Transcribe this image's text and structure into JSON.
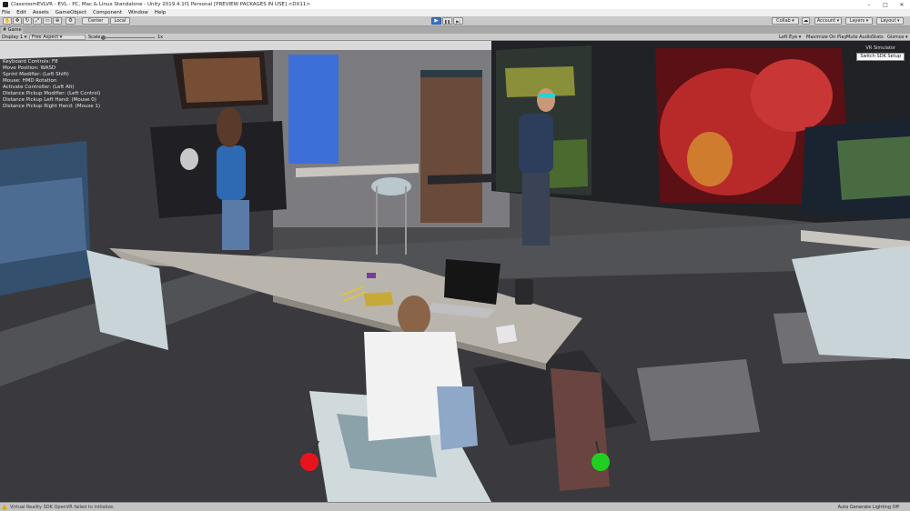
{
  "window": {
    "title": "ClassroomEVLVR - EVL - PC, Mac & Linux Standalone - Unity 2019.4.1f1 Personal [PREVIEW PACKAGES IN USE] <DX11>",
    "controls": [
      "–",
      "□",
      "✕"
    ]
  },
  "menu": [
    "File",
    "Edit",
    "Assets",
    "GameObject",
    "Component",
    "Window",
    "Help"
  ],
  "toolbar": {
    "center_label": "Center",
    "local_label": "Local",
    "play_icon": "▶",
    "pause_icon": "❚❚",
    "step_icon": "▶|",
    "collab_label": "Collab ▾",
    "account_label": "Account ▾",
    "layers_label": "Layers ▾",
    "layout_label": "Layout ▾"
  },
  "tabs": {
    "game": "# Game"
  },
  "gameview": {
    "display": "Display 1 ▾",
    "aspect": "Free Aspect ▾",
    "scale_label": "Scale",
    "scale_value": "1x",
    "eye": "Left Eye ▾",
    "maximize": "Maximize On Play",
    "mute": "Mute Audio",
    "stats": "Stats",
    "gizmos": "Gizmos ▾"
  },
  "debug_overlay": {
    "lines": [
      "Keyboard Controls: F8",
      "Move Position: WASD",
      "Sprint Modifier: (Left Shift)",
      "",
      "Mouse: HMD Rotation",
      "Activate Controller: (Left Alt)",
      "Distance Pickup Modifier: (Left Control)",
      "Distance Pickup Left Hand: (Mouse 0)",
      "Distance Pickup Right Hand: (Mouse 1)"
    ]
  },
  "sdk": {
    "label": "VR Simulator",
    "button": "Switch SDK Setup"
  },
  "status": {
    "message": "Virtual Reality SDK OpenVR failed to initialize.",
    "right": "Auto Generate Lighting Off"
  },
  "colors": {
    "play_active": "#3a72c4",
    "controller_left": "#e8141c",
    "controller_right": "#20d020",
    "screen_blue": "#3d6fd8"
  }
}
